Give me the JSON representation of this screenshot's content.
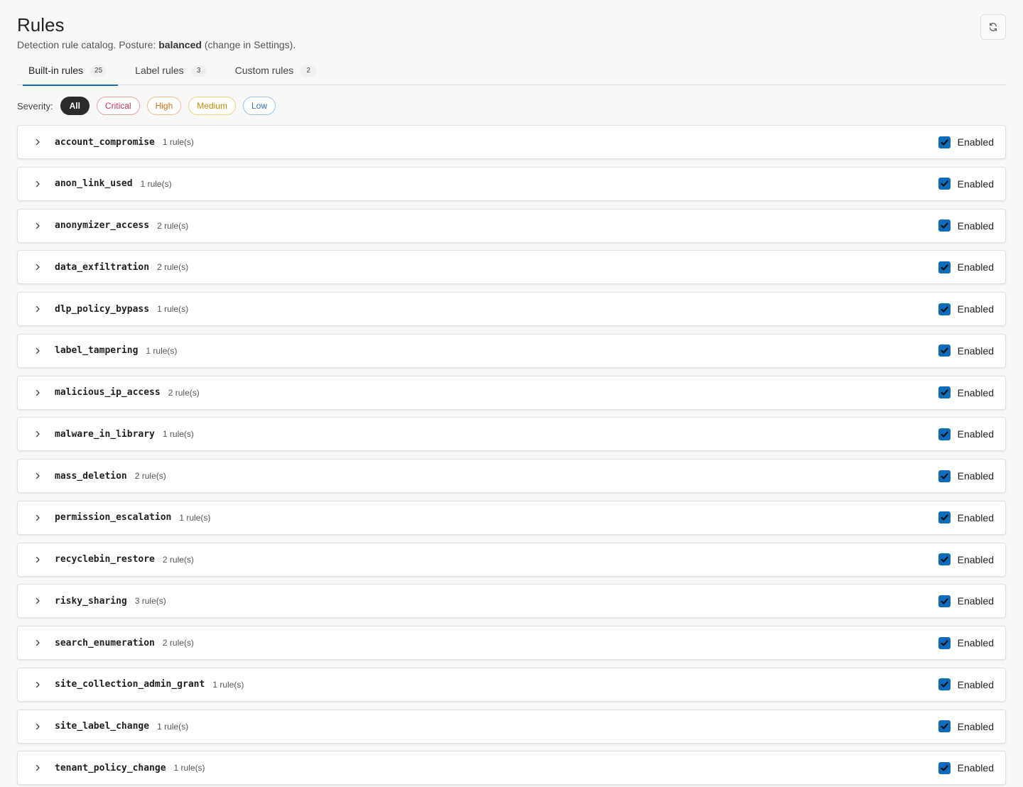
{
  "header": {
    "title": "Rules",
    "subtitle_prefix": "Detection rule catalog. Posture: ",
    "posture": "balanced",
    "subtitle_suffix": " (change in Settings).",
    "refresh_icon": "refresh-icon"
  },
  "tabs": [
    {
      "label": "Built-in rules",
      "count": "25",
      "active": true
    },
    {
      "label": "Label rules",
      "count": "3",
      "active": false
    },
    {
      "label": "Custom rules",
      "count": "2",
      "active": false
    }
  ],
  "severity": {
    "label": "Severity:",
    "options": [
      "All",
      "Critical",
      "High",
      "Medium",
      "Low"
    ],
    "selected": "All",
    "colors": {
      "critical": "#c4314b",
      "high": "#d66a14",
      "medium": "#c28a00",
      "low": "#2b6fc2"
    }
  },
  "rules": [
    {
      "name": "account_compromise",
      "count": "1 rule(s)",
      "status": "Enabled",
      "enabled": true
    },
    {
      "name": "anon_link_used",
      "count": "1 rule(s)",
      "status": "Enabled",
      "enabled": true
    },
    {
      "name": "anonymizer_access",
      "count": "2 rule(s)",
      "status": "Enabled",
      "enabled": true
    },
    {
      "name": "data_exfiltration",
      "count": "2 rule(s)",
      "status": "Enabled",
      "enabled": true
    },
    {
      "name": "dlp_policy_bypass",
      "count": "1 rule(s)",
      "status": "Enabled",
      "enabled": true
    },
    {
      "name": "label_tampering",
      "count": "1 rule(s)",
      "status": "Enabled",
      "enabled": true
    },
    {
      "name": "malicious_ip_access",
      "count": "2 rule(s)",
      "status": "Enabled",
      "enabled": true
    },
    {
      "name": "malware_in_library",
      "count": "1 rule(s)",
      "status": "Enabled",
      "enabled": true
    },
    {
      "name": "mass_deletion",
      "count": "2 rule(s)",
      "status": "Enabled",
      "enabled": true
    },
    {
      "name": "permission_escalation",
      "count": "1 rule(s)",
      "status": "Enabled",
      "enabled": true
    },
    {
      "name": "recyclebin_restore",
      "count": "2 rule(s)",
      "status": "Enabled",
      "enabled": true
    },
    {
      "name": "risky_sharing",
      "count": "3 rule(s)",
      "status": "Enabled",
      "enabled": true
    },
    {
      "name": "search_enumeration",
      "count": "2 rule(s)",
      "status": "Enabled",
      "enabled": true
    },
    {
      "name": "site_collection_admin_grant",
      "count": "1 rule(s)",
      "status": "Enabled",
      "enabled": true
    },
    {
      "name": "site_label_change",
      "count": "1 rule(s)",
      "status": "Enabled",
      "enabled": true
    },
    {
      "name": "tenant_policy_change",
      "count": "1 rule(s)",
      "status": "Enabled",
      "enabled": true
    }
  ],
  "accent_color": "#0f6cbd"
}
